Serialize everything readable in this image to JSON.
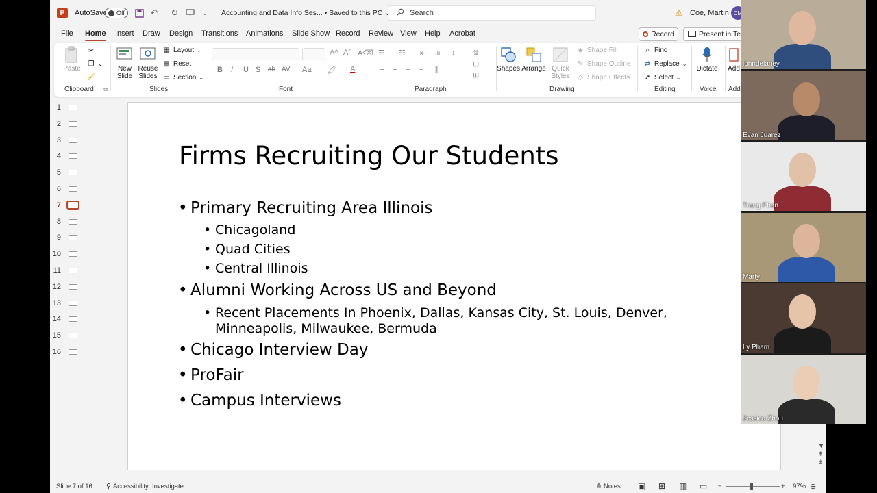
{
  "titlebar": {
    "autosave_label": "AutoSave",
    "autosave_state": "Off",
    "doc_name": "Accounting and Data Info Ses... • Saved to this PC ⌄",
    "search_placeholder": "Search",
    "user_name": "Coe, Martin J",
    "user_initials": "CM"
  },
  "menu": {
    "items": [
      "File",
      "Home",
      "Insert",
      "Draw",
      "Design",
      "Transitions",
      "Animations",
      "Slide Show",
      "Record",
      "Review",
      "View",
      "Help",
      "Acrobat"
    ],
    "active": "Home",
    "record_label": "Record",
    "present_label": "Present in Teams"
  },
  "ribbon": {
    "clipboard": {
      "paste": "Paste",
      "group": "Clipboard"
    },
    "slides": {
      "new_slide": "New Slide",
      "reuse_slides": "Reuse Slides",
      "layout": "Layout",
      "reset": "Reset",
      "section": "Section",
      "group": "Slides"
    },
    "font": {
      "group": "Font",
      "buttons": [
        "B",
        "I",
        "U",
        "S",
        "ab",
        "AV",
        "Aa"
      ]
    },
    "paragraph": {
      "group": "Paragraph"
    },
    "drawing": {
      "shapes": "Shapes",
      "arrange": "Arrange",
      "quick_styles": "Quick Styles",
      "shape_fill": "Shape Fill",
      "shape_outline": "Shape Outline",
      "shape_effects": "Shape Effects",
      "group": "Drawing"
    },
    "editing": {
      "find": "Find",
      "replace": "Replace",
      "select": "Select",
      "group": "Editing"
    },
    "voice": {
      "dictate": "Dictate",
      "group": "Voice"
    },
    "add": {
      "label": "Add",
      "group": "Add"
    }
  },
  "thumbnails": {
    "numbers": [
      "1",
      "2",
      "3",
      "4",
      "5",
      "6",
      "7",
      "8",
      "9",
      "10",
      "11",
      "12",
      "13",
      "14",
      "15",
      "16"
    ],
    "active_index": 7
  },
  "slide": {
    "title": "Firms Recruiting Our Students",
    "bullets": {
      "primary": "Primary Recruiting Area Illinois",
      "chicagoland": "Chicagoland",
      "quad_cities": "Quad Cities",
      "central_illinois": "Central Illinois",
      "alumni": "Alumni Working Across US and Beyond",
      "placements_line1": "Recent Placements In Phoenix, Dallas, Kansas City, St. Louis, Denver,",
      "placements_line2": "Minneapolis, Milwaukee, Bermuda",
      "chicago_day": "Chicago Interview Day",
      "profair": "ProFair",
      "campus": "Campus Interviews"
    }
  },
  "statusbar": {
    "slide_count": "Slide 7 of 16",
    "accessibility": "Accessibility: Investigate",
    "notes": "Notes",
    "zoom": "97%"
  },
  "participants": [
    {
      "name": "johndelaney",
      "bg": "#b9ad9a",
      "skin": "#e0b8a0",
      "shirt": "#2f4e7d"
    },
    {
      "name": "Evan Juarez",
      "bg": "#7d6a5d",
      "skin": "#b88a6a",
      "shirt": "#1e1e2a"
    },
    {
      "name": "Trang Phan",
      "bg": "#e9e9e9",
      "skin": "#e1c1a8",
      "shirt": "#8e2b33"
    },
    {
      "name": "Marty",
      "bg": "#a89878",
      "skin": "#dcb59a",
      "shirt": "#2e59a8"
    },
    {
      "name": "Ly Pham",
      "bg": "#4a3a32",
      "skin": "#e6c4a9",
      "shirt": "#1b1b1b"
    },
    {
      "name": "Jessica Zhou",
      "bg": "#d9d7d2",
      "skin": "#ebcdb5",
      "shirt": "#2a2a2a"
    }
  ],
  "colors": {
    "accent": "#b7472a",
    "ppt_brand": "#c43e1c"
  }
}
